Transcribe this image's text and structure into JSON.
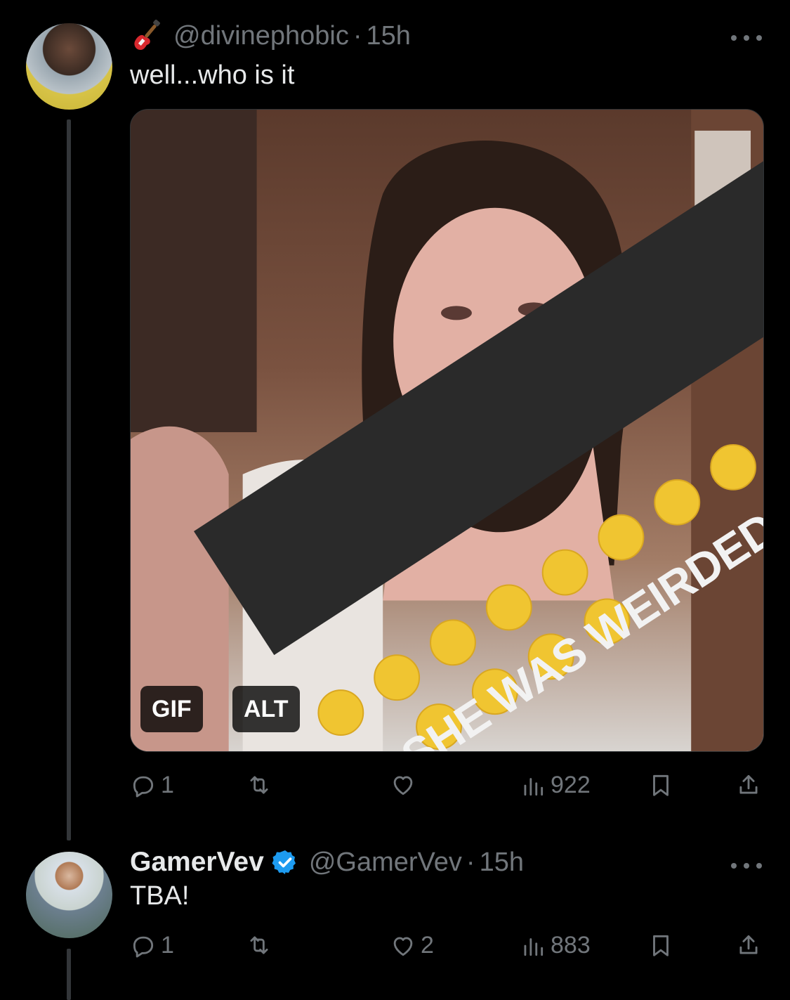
{
  "tweets": [
    {
      "emoji_icon": "guitar-icon",
      "handle": "@divinephobic",
      "separator": "·",
      "time": "15h",
      "text": "well...who is it",
      "media": {
        "caption": "EVEN SHE WAS WEIRDED TF OUT",
        "gif_badge": "GIF",
        "alt_badge": "ALT"
      },
      "stats": {
        "replies": "1",
        "retweets": "",
        "likes": "",
        "views": "922"
      }
    },
    {
      "name": "GamerVev",
      "verified": true,
      "handle": "@GamerVev",
      "separator": "·",
      "time": "15h",
      "text": "TBA!",
      "stats": {
        "replies": "1",
        "retweets": "",
        "likes": "2",
        "views": "883"
      }
    }
  ],
  "colors": {
    "background": "#000000",
    "text": "#e7e9ea",
    "muted": "#71767b",
    "verified": "#1d9bf0"
  }
}
